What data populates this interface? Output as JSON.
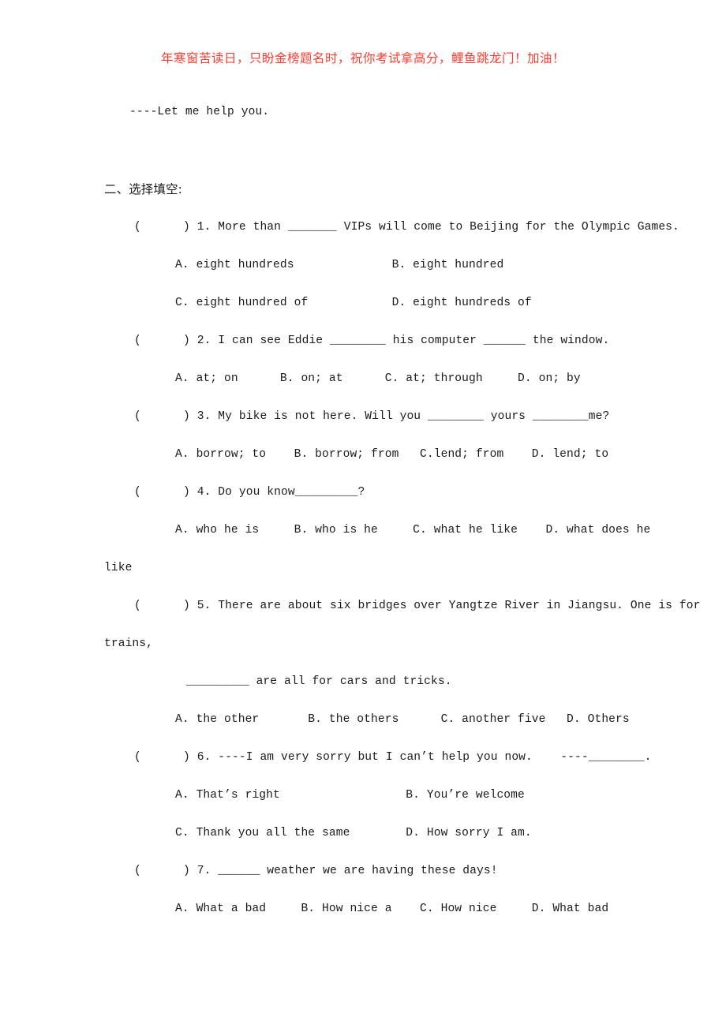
{
  "banner": {
    "text": "年寒窗苦读日，只盼金榜题名时，祝你考试拿高分，鲤鱼跳龙门！加油！",
    "color": "#fb3b30"
  },
  "lead_line": "----Let me help you.",
  "section": {
    "heading": "二、选择填空:"
  },
  "questions": [
    {
      "marker": "(      ) 1.",
      "stem": "(      ) 1. More than _______ VIPs will come to Beijing for the Olympic Games.",
      "option_lines": [
        "A. eight hundreds              B. eight hundred",
        "C. eight hundred of            D. eight hundreds of"
      ]
    },
    {
      "marker": "(      ) 2.",
      "stem": "(      ) 2. I can see Eddie ________ his computer ______ the window.",
      "option_lines": [
        "A. at; on      B. on; at      C. at; through     D. on; by"
      ]
    },
    {
      "marker": "(      ) 3.",
      "stem": "(      ) 3. My bike is not here. Will you ________ yours ________me?",
      "option_lines": [
        "A. borrow; to    B. borrow; from   C.lend; from    D. lend; to"
      ]
    },
    {
      "marker": "(      ) 4.",
      "stem": "(      ) 4. Do you know_________?",
      "option_lines": [
        "A. who he is     B. who is he     C. what he like    D. what does he"
      ],
      "continuation": "like"
    },
    {
      "marker": "(      ) 5.",
      "stem": "(      ) 5. There are about six bridges over Yangtze River in Jiangsu. One is for",
      "continuation": "trains,",
      "blank_line": "_________ are all for cars and tricks.",
      "option_lines": [
        "A. the other       B. the others      C. another five   D. Others"
      ]
    },
    {
      "marker": "(      ) 6.",
      "stem": "(      ) 6. ----I am very sorry but I can’t help you now.    ----________.",
      "option_lines": [
        "A. That’s right                  B. You’re welcome",
        "C. Thank you all the same        D. How sorry I am."
      ]
    },
    {
      "marker": "(      ) 7.",
      "stem": "(      ) 7. ______ weather we are having these days!",
      "option_lines": [
        "A. What a bad     B. How nice a    C. How nice     D. What bad"
      ]
    }
  ]
}
